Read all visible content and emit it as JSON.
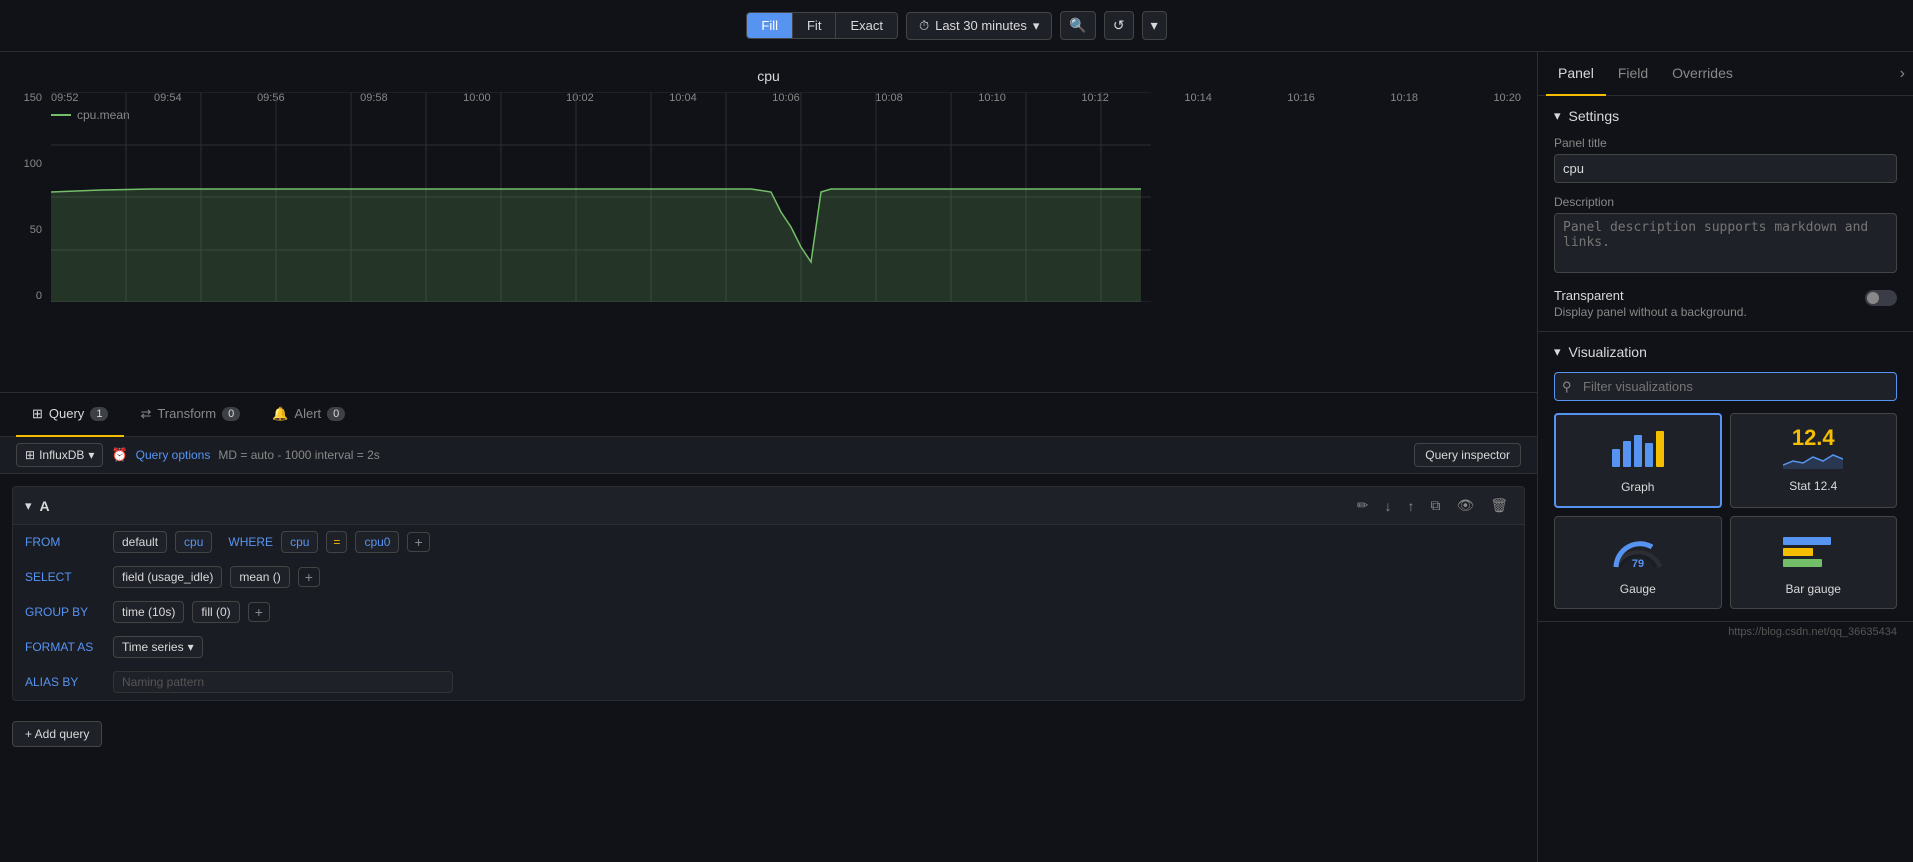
{
  "toolbar": {
    "fill_label": "Fill",
    "fit_label": "Fit",
    "exact_label": "Exact",
    "time_range": "Last 30 minutes",
    "zoom_icon": "🔍",
    "refresh_icon": "↺",
    "chevron_down": "▾"
  },
  "chart": {
    "title": "cpu",
    "y_axis": [
      "150",
      "100",
      "50",
      "0"
    ],
    "x_axis": [
      "09:52",
      "09:54",
      "09:56",
      "09:58",
      "10:00",
      "10:02",
      "10:04",
      "10:06",
      "10:08",
      "10:10",
      "10:12",
      "10:14",
      "10:16",
      "10:18",
      "10:20"
    ],
    "legend_label": "cpu.mean"
  },
  "tabs": {
    "query_label": "Query",
    "query_count": "1",
    "transform_label": "Transform",
    "transform_count": "0",
    "alert_label": "Alert",
    "alert_count": "0"
  },
  "query_toolbar": {
    "datasource": "InfluxDB",
    "clock_icon": "⏰",
    "query_options_label": "Query options",
    "query_meta": "MD = auto - 1000   interval = 2s",
    "inspector_label": "Query inspector"
  },
  "query_builder": {
    "letter": "A",
    "from_label": "FROM",
    "from_default": "default",
    "from_cpu": "cpu",
    "where_label": "WHERE",
    "where_cpu": "cpu",
    "where_eq": "=",
    "where_cpu0": "cpu0",
    "select_label": "SELECT",
    "select_field": "field (usage_idle)",
    "select_mean": "mean ()",
    "group_by_label": "GROUP BY",
    "group_time": "time (10s)",
    "group_fill": "fill (0)",
    "format_label": "FORMAT AS",
    "format_value": "Time series",
    "alias_label": "ALIAS BY",
    "alias_placeholder": "Naming pattern"
  },
  "panel_tabs": {
    "panel_label": "Panel",
    "field_label": "Field",
    "overrides_label": "Overrides",
    "collapse_icon": "›"
  },
  "settings": {
    "section_title": "Settings",
    "panel_title_label": "Panel title",
    "panel_title_value": "cpu",
    "description_label": "Description",
    "description_placeholder": "Panel description supports markdown and links.",
    "transparent_label": "Transparent",
    "transparent_desc": "Display panel without a background."
  },
  "visualization": {
    "section_title": "Visualization",
    "filter_placeholder": "Filter visualizations",
    "cards": [
      {
        "id": "graph",
        "label": "Graph",
        "selected": true
      },
      {
        "id": "stat",
        "label": "Stat 12.4",
        "selected": false
      },
      {
        "id": "gauge",
        "label": "Gauge",
        "selected": false
      },
      {
        "id": "bar-gauge",
        "label": "Bar gauge",
        "selected": false
      }
    ]
  },
  "footer": {
    "url": "https://blog.csdn.net/qq_36635434"
  }
}
